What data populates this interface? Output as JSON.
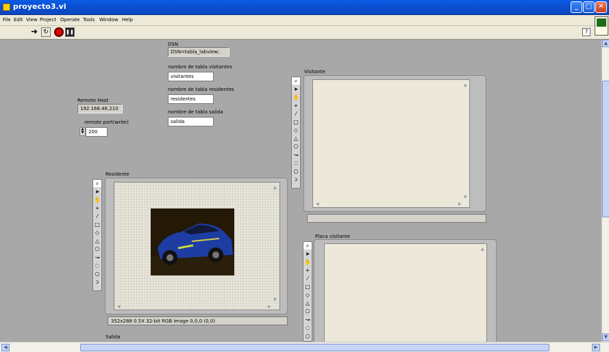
{
  "window": {
    "title": "proyecto3.vi"
  },
  "menu": [
    "File",
    "Edit",
    "View",
    "Project",
    "Operate",
    "Tools",
    "Window",
    "Help"
  ],
  "toolbar": {
    "help_glyph": "?"
  },
  "controls": {
    "dsn": {
      "label": "DSN",
      "value": "DSN=tabla_labview;"
    },
    "tabla_visitantes": {
      "label": "nombre de tabla visitantes",
      "value": "visitantes"
    },
    "tabla_residentes": {
      "label": "nombre de tabla residentes",
      "value": "residentes"
    },
    "tabla_salida": {
      "label": "nombre de tabla salida",
      "value": "salida"
    },
    "remote_host": {
      "label": "Remote Host",
      "value": "192.168.46.210"
    },
    "remote_port": {
      "label": "remote port(write)",
      "value": "200"
    }
  },
  "displays": {
    "visitante": {
      "label": "Visitante"
    },
    "residente": {
      "label": "Residente",
      "status": "352x288 0.5X 32-bit RGB image 0,0,0    (0,0)"
    },
    "placa_visitante": {
      "label": "Placa visitante"
    },
    "salida": {
      "label": "Salida"
    }
  },
  "icons": {
    "palette": [
      "zoom-icon",
      "pointer-icon",
      "pan-hand-icon",
      "point-icon",
      "line-icon",
      "rectangle-icon",
      "rotated-rect-icon",
      "annulus-icon",
      "polygon-icon",
      "freehand-icon",
      "oval-icon",
      "broken-line-icon",
      "freehand-line-icon"
    ]
  }
}
